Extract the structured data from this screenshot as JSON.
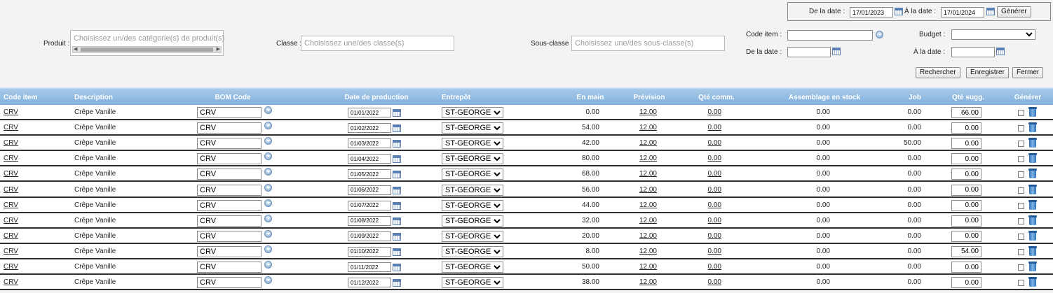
{
  "top_dates": {
    "from_label": "De la date :",
    "from_value": "17/01/2023",
    "to_label": "À la date :",
    "to_value": "17/01/2024",
    "generate_label": "Générer"
  },
  "filters": {
    "produit_label": "Produit :",
    "produit_placeholder": "Choisissez un/des catégorie(s) de produit(s)",
    "classe_label": "Classe :",
    "classe_placeholder": "Choisissez une/des classe(s)",
    "sousclasse_label": "Sous-classe :",
    "sousclasse_placeholder": "Choisissez une/des sous-classe(s)",
    "code_item_label": "Code item :",
    "code_item_value": "",
    "budget_label": "Budget :",
    "budget_value": "",
    "from_label": "De la date :",
    "from_value": "",
    "to_label": "À la date :",
    "to_value": ""
  },
  "actions": {
    "search": "Rechercher",
    "save": "Enregistrer",
    "close": "Fermer"
  },
  "columns": {
    "code": "Code item",
    "desc": "Description",
    "bom": "BOM Code",
    "date": "Date de production",
    "warehouse": "Entrepôt",
    "onhand": "En main",
    "forecast": "Prévision",
    "ordered": "Qté comm.",
    "assembly": "Assemblage en stock",
    "job": "Job",
    "suggested": "Qté sugg.",
    "generate": "Générer"
  },
  "rows": [
    {
      "code": "CRV",
      "desc": "Crêpe Vanille",
      "bom": "CRV",
      "date": "01/01/2022",
      "wh": "ST-GEORGES",
      "onhand": "0.00",
      "forecast": "12.00",
      "ordered": "0.00",
      "assembly": "0.00",
      "job": "0.00",
      "sugg": "66.00"
    },
    {
      "code": "CRV",
      "desc": "Crêpe Vanille",
      "bom": "CRV",
      "date": "01/02/2022",
      "wh": "ST-GEORGES",
      "onhand": "54.00",
      "forecast": "12.00",
      "ordered": "0.00",
      "assembly": "0.00",
      "job": "0.00",
      "sugg": "0.00"
    },
    {
      "code": "CRV",
      "desc": "Crêpe Vanille",
      "bom": "CRV",
      "date": "01/03/2022",
      "wh": "ST-GEORGES",
      "onhand": "42.00",
      "forecast": "12.00",
      "ordered": "0.00",
      "assembly": "0.00",
      "job": "50.00",
      "sugg": "0.00"
    },
    {
      "code": "CRV",
      "desc": "Crêpe Vanille",
      "bom": "CRV",
      "date": "01/04/2022",
      "wh": "ST-GEORGES",
      "onhand": "80.00",
      "forecast": "12.00",
      "ordered": "0.00",
      "assembly": "0.00",
      "job": "0.00",
      "sugg": "0.00"
    },
    {
      "code": "CRV",
      "desc": "Crêpe Vanille",
      "bom": "CRV",
      "date": "01/05/2022",
      "wh": "ST-GEORGES",
      "onhand": "68.00",
      "forecast": "12.00",
      "ordered": "0.00",
      "assembly": "0.00",
      "job": "0.00",
      "sugg": "0.00"
    },
    {
      "code": "CRV",
      "desc": "Crêpe Vanille",
      "bom": "CRV",
      "date": "01/06/2022",
      "wh": "ST-GEORGES",
      "onhand": "56.00",
      "forecast": "12.00",
      "ordered": "0.00",
      "assembly": "0.00",
      "job": "0.00",
      "sugg": "0.00"
    },
    {
      "code": "CRV",
      "desc": "Crêpe Vanille",
      "bom": "CRV",
      "date": "01/07/2022",
      "wh": "ST-GEORGES",
      "onhand": "44.00",
      "forecast": "12.00",
      "ordered": "0.00",
      "assembly": "0.00",
      "job": "0.00",
      "sugg": "0.00"
    },
    {
      "code": "CRV",
      "desc": "Crêpe Vanille",
      "bom": "CRV",
      "date": "01/08/2022",
      "wh": "ST-GEORGES",
      "onhand": "32.00",
      "forecast": "12.00",
      "ordered": "0.00",
      "assembly": "0.00",
      "job": "0.00",
      "sugg": "0.00"
    },
    {
      "code": "CRV",
      "desc": "Crêpe Vanille",
      "bom": "CRV",
      "date": "01/09/2022",
      "wh": "ST-GEORGES",
      "onhand": "20.00",
      "forecast": "12.00",
      "ordered": "0.00",
      "assembly": "0.00",
      "job": "0.00",
      "sugg": "0.00"
    },
    {
      "code": "CRV",
      "desc": "Crêpe Vanille",
      "bom": "CRV",
      "date": "01/10/2022",
      "wh": "ST-GEORGES",
      "onhand": "8.00",
      "forecast": "12.00",
      "ordered": "0.00",
      "assembly": "0.00",
      "job": "0.00",
      "sugg": "54.00"
    },
    {
      "code": "CRV",
      "desc": "Crêpe Vanille",
      "bom": "CRV",
      "date": "01/11/2022",
      "wh": "ST-GEORGES",
      "onhand": "50.00",
      "forecast": "12.00",
      "ordered": "0.00",
      "assembly": "0.00",
      "job": "0.00",
      "sugg": "0.00"
    },
    {
      "code": "CRV",
      "desc": "Crêpe Vanille",
      "bom": "CRV",
      "date": "01/12/2022",
      "wh": "ST-GEORGES",
      "onhand": "38.00",
      "forecast": "12.00",
      "ordered": "0.00",
      "assembly": "0.00",
      "job": "0.00",
      "sugg": "0.00"
    }
  ]
}
